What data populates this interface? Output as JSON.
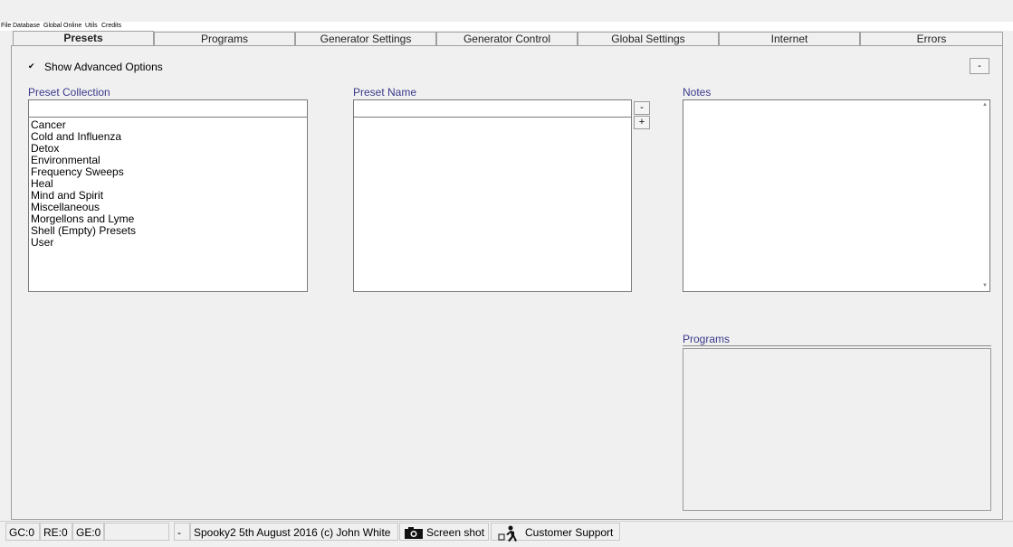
{
  "menu": [
    "File",
    "Database",
    "Global",
    "Online",
    "Utils",
    "Credits"
  ],
  "tabs": [
    "Presets",
    "Programs",
    "Generator Settings",
    "Generator Control",
    "Global Settings",
    "Internet",
    "Errors"
  ],
  "show_advanced": {
    "label": "Show Advanced Options",
    "checked": true,
    "check_glyph": "✔"
  },
  "collapse_button": "-",
  "preset_collection": {
    "label": "Preset Collection",
    "search_value": "",
    "items": [
      "Cancer",
      "Cold and Influenza",
      "Detox",
      "Environmental",
      "Frequency Sweeps",
      "Heal",
      "Mind and Spirit",
      "Miscellaneous",
      "Morgellons and Lyme",
      "Shell (Empty) Presets",
      "User"
    ]
  },
  "preset_name": {
    "label": "Preset Name",
    "value": "",
    "minus": "-",
    "plus": "+"
  },
  "notes": {
    "label": "Notes",
    "value": ""
  },
  "programs": {
    "label": "Programs"
  },
  "status": {
    "gc": "GC:0",
    "re": "RE:0",
    "ge": "GE:0",
    "blank": "",
    "dash": "-",
    "credit": "Spooky2 5th August 2016 (c) John White",
    "screenshot": "Screen shot",
    "support": "Customer Support"
  }
}
